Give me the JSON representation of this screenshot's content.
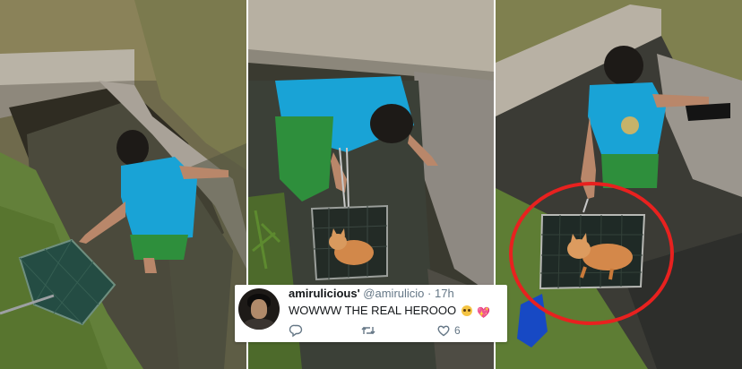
{
  "tweet": {
    "display_name": "amirulicious'",
    "handle": "@amirulicio",
    "separator": "·",
    "time": "17h",
    "text": "WOWWW THE REAL HEROOO",
    "emojis": [
      "pleading-face-emoji",
      "sparkling-heart-emoji"
    ],
    "reply_count": "",
    "retweet_count": "",
    "like_count": "6"
  },
  "colors": {
    "tweet_text": "#14171a",
    "secondary_text": "#657786",
    "highlight_circle": "#e8211f"
  },
  "icons": [
    "reply-icon",
    "retweet-icon",
    "heart-icon"
  ]
}
